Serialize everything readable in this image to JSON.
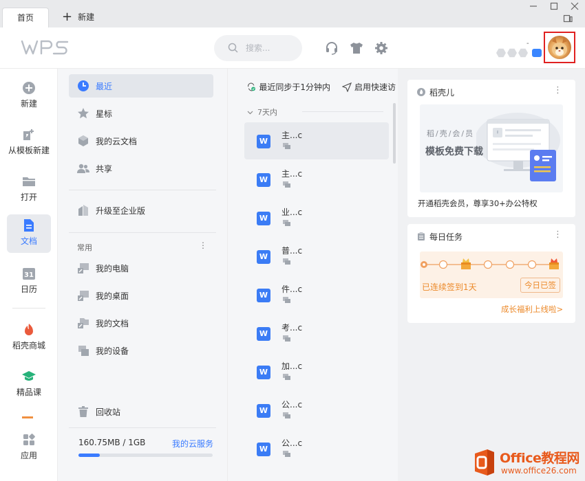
{
  "tabs": [
    {
      "label": "首页"
    },
    {
      "label": "新建"
    }
  ],
  "header": {
    "logo": "WPS",
    "search_placeholder": "搜索...",
    "user_dash": "-"
  },
  "left_nav": [
    {
      "label": "新建",
      "icon": "plus-circle-icon"
    },
    {
      "label": "从模板新建",
      "icon": "template-icon"
    },
    {
      "label": "打开",
      "icon": "folder-icon"
    },
    {
      "label": "文档",
      "icon": "document-icon",
      "active": true
    },
    {
      "label": "日历",
      "icon": "calendar-icon",
      "day": "31"
    },
    {
      "label": "稻壳商城",
      "icon": "docer-store-icon"
    },
    {
      "label": "精品课",
      "icon": "course-icon"
    },
    {
      "label": "应用",
      "icon": "apps-icon"
    }
  ],
  "sub_nav": {
    "items": [
      {
        "label": "最近",
        "icon": "clock-icon",
        "active": true
      },
      {
        "label": "星标",
        "icon": "star-icon"
      },
      {
        "label": "我的云文档",
        "icon": "cloud-doc-icon"
      },
      {
        "label": "共享",
        "icon": "share-icon"
      }
    ],
    "upgrade": "升级至企业版",
    "common_heading": "常用",
    "more": "⋮",
    "common": [
      {
        "label": "我的电脑"
      },
      {
        "label": "我的桌面"
      },
      {
        "label": "我的文档"
      },
      {
        "label": "我的设备"
      }
    ],
    "trash": "回收站",
    "storage": "160.75MB / 1GB",
    "cloud_service": "我的云服务",
    "storage_used_fraction": 0.157
  },
  "file_list": {
    "sync_status": "最近同步于1分钟内",
    "quick_access": "启用快速访",
    "group": "7天内",
    "files": [
      {
        "name": "主...c",
        "active": true
      },
      {
        "name": "主...c"
      },
      {
        "name": "业...c"
      },
      {
        "name": "普...c"
      },
      {
        "name": "件...c"
      },
      {
        "name": "考...c"
      },
      {
        "name": "加...c"
      },
      {
        "name": "公...c"
      },
      {
        "name": "公...c"
      }
    ],
    "file_icon_letter": "W"
  },
  "right_panel": {
    "docer_card": {
      "title": "稻壳儿",
      "promo_line1": "稻/壳/会/员",
      "promo_line2": "模板免费下载",
      "promo_text": "开通稻壳会员，尊享30+办公特权"
    },
    "task_card": {
      "title": "每日任务",
      "streak": "已连续签到1天",
      "checked_in": "今日已签",
      "growth_link": "成长福利上线啦>"
    }
  },
  "watermark": {
    "title": "Office教程网",
    "url": "www.office26.com"
  },
  "colors": {
    "accent": "#3a7bff",
    "orange": "#ec8a2b",
    "highlight_box": "#e02020"
  }
}
